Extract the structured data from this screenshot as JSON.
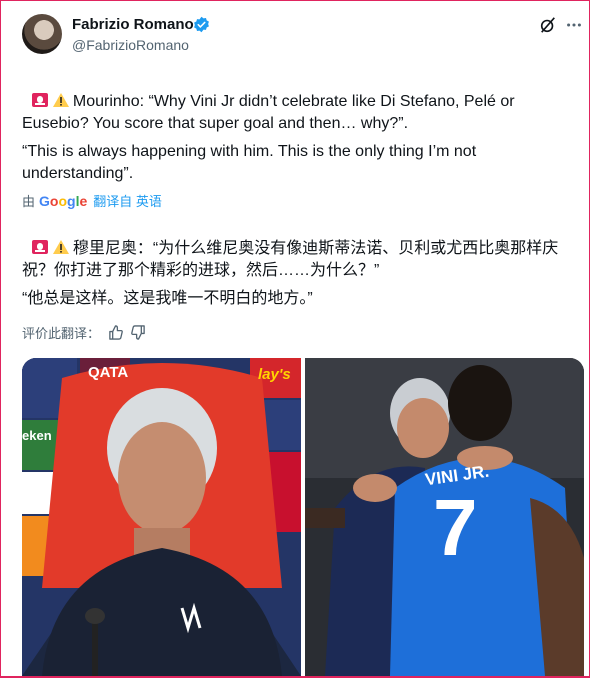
{
  "author": {
    "name": "Fabrizio Romano",
    "handle": "@FabrizioRomano"
  },
  "header_icons": [
    "grok-icon",
    "more-icon"
  ],
  "tweet": {
    "english_line1": "Mourinho: “Why Vini Jr didn’t celebrate like Di Stefano, Pelé or Eusebio? You score that super goal and then… why?”.",
    "english_line2": "“This is always happening with him. This is the only thing I’m not understanding”."
  },
  "translation": {
    "by_label": "由",
    "provider": "Google",
    "action": "翻译自 英语",
    "chinese_line1": "穆里尼奥：“为什么维尼奥没有像迪斯蒂法诺、贝利或尤西比奥那样庆祝？你打进了那个精彩的进球，然后……为什么？”",
    "chinese_line2": "“他总是这样。这是我唯一不明白的地方。”",
    "rate_label": "评价此翻译："
  },
  "media": {
    "left_alt": "Mourinho at press conference",
    "right_alt": "Mourinho hugging Vini Jr",
    "shirt_name": "VINI JR.",
    "shirt_number": "7",
    "board_text_1": "QATA",
    "board_text_2": "lay's",
    "board_text_3": "eken"
  },
  "colors": {
    "frame_border": "#e0245e",
    "link": "#1d9bf0",
    "verified": "#1d9bf0",
    "shirt": "#1e6fd9"
  }
}
